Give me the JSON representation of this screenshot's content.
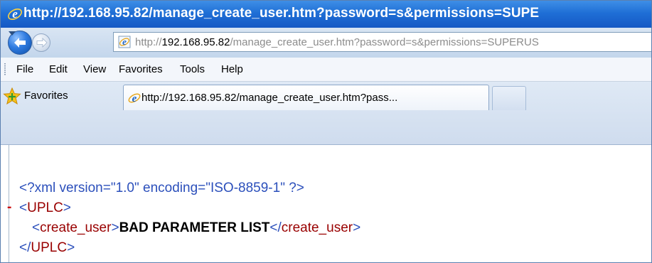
{
  "window": {
    "title": "http://192.168.95.82/manage_create_user.htm?password=s&permissions=SUPE"
  },
  "address": {
    "prefix": "http://",
    "host": "192.168.95.82",
    "path": "/manage_create_user.htm?password=s&permissions=SUPERUS"
  },
  "menu": {
    "file": "File",
    "edit": "Edit",
    "view": "View",
    "favorites": "Favorites",
    "tools": "Tools",
    "help": "Help"
  },
  "favorites_bar": {
    "label": "Favorites"
  },
  "tabs": [
    {
      "label": "http://192.168.95.82/manage_create_user.htm?pass..."
    }
  ],
  "xml": {
    "declaration": "<?xml version=\"1.0\" encoding=\"ISO-8859-1\" ?>",
    "collapse_glyph": "-",
    "lt": "<",
    "gt": ">",
    "lt_slash": "</",
    "root_tag": "UPLC",
    "child_tag": "create_user",
    "child_text": "BAD PARAMETER LIST"
  },
  "icons": {
    "title": "ie-logo-icon",
    "back": "back-arrow-icon",
    "forward": "forward-arrow-icon",
    "page": "ie-page-icon",
    "favorites": "star-icon"
  }
}
